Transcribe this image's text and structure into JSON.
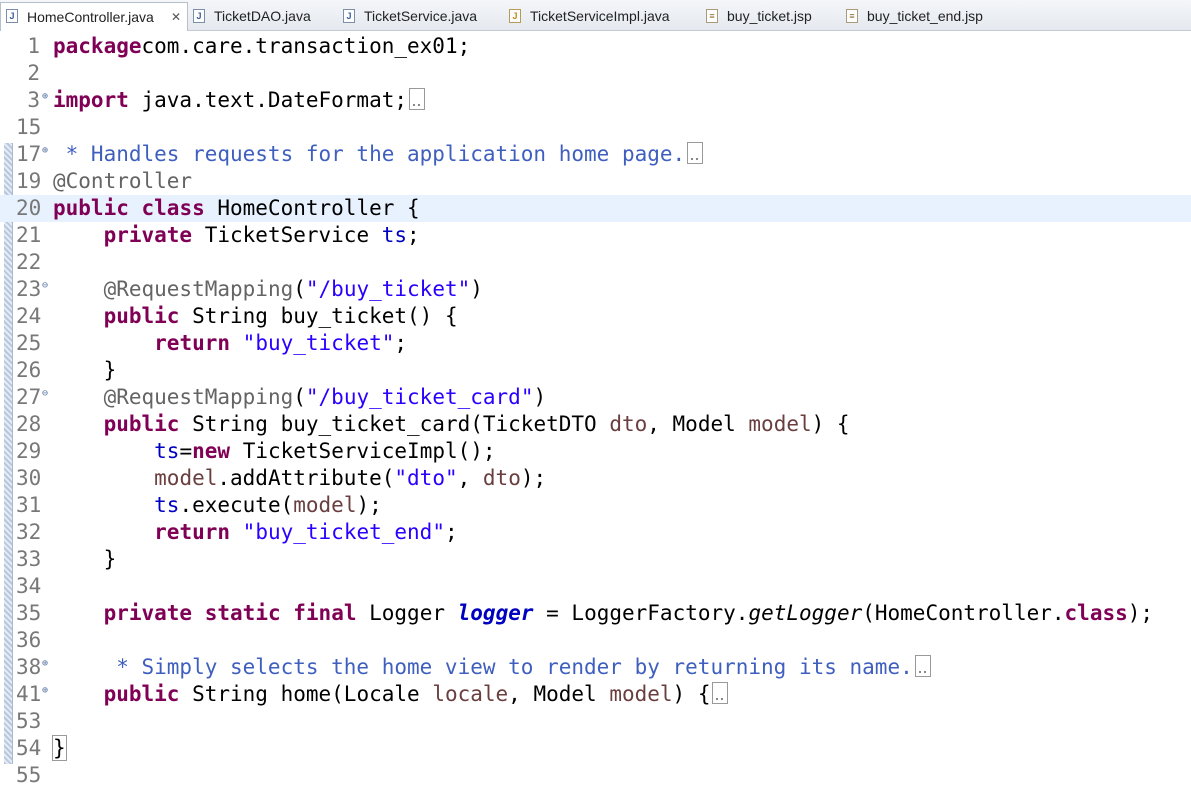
{
  "tabs": [
    {
      "label": "HomeController.java",
      "icon": "java-file-icon",
      "active": true,
      "close": "✕"
    },
    {
      "label": "TicketDAO.java",
      "icon": "java-file-icon"
    },
    {
      "label": "TicketService.java",
      "icon": "java-file-icon"
    },
    {
      "label": "TicketServiceImpl.java",
      "icon": "java-file-icon"
    },
    {
      "label": "buy_ticket.jsp",
      "icon": "jsp-file-icon"
    },
    {
      "label": "buy_ticket_end.jsp",
      "icon": "jsp-file-icon"
    }
  ],
  "editor": {
    "current_line": "20",
    "lines": [
      {
        "n": "1",
        "fold": "",
        "tokens": [
          [
            "kw",
            "package"
          ],
          [
            "",
            "com.care.transaction_ex01;"
          ]
        ]
      },
      {
        "n": "2",
        "fold": "",
        "tokens": []
      },
      {
        "n": "3",
        "fold": "+",
        "tokens": [
          [
            "kw",
            "import"
          ],
          [
            "",
            " java.text.DateFormat;"
          ],
          [
            "box",
            ""
          ]
        ]
      },
      {
        "n": "15",
        "fold": "",
        "tokens": []
      },
      {
        "n": "17",
        "fold": "+",
        "tokens": [
          [
            "cmt",
            " * Handles requests for the application home page."
          ],
          [
            "box",
            ""
          ]
        ]
      },
      {
        "n": "19",
        "fold": "",
        "tokens": [
          [
            "ann",
            "@Controller"
          ]
        ]
      },
      {
        "n": "20",
        "fold": "",
        "tokens": [
          [
            "kw",
            "public"
          ],
          [
            "",
            " "
          ],
          [
            "kw",
            "class"
          ],
          [
            "",
            " HomeController {"
          ]
        ]
      },
      {
        "n": "21",
        "fold": "",
        "tokens": [
          [
            "",
            "    "
          ],
          [
            "kw",
            "private"
          ],
          [
            "",
            " TicketService "
          ],
          [
            "fld",
            "ts"
          ],
          [
            "",
            ";"
          ]
        ]
      },
      {
        "n": "22",
        "fold": "",
        "tokens": []
      },
      {
        "n": "23",
        "fold": "-",
        "tokens": [
          [
            "",
            "    "
          ],
          [
            "ann",
            "@RequestMapping"
          ],
          [
            "",
            "("
          ],
          [
            "str",
            "\"/buy_ticket\""
          ],
          [
            "",
            ")"
          ]
        ]
      },
      {
        "n": "24",
        "fold": "",
        "tokens": [
          [
            "",
            "    "
          ],
          [
            "kw",
            "public"
          ],
          [
            "",
            " String buy_ticket() {"
          ]
        ]
      },
      {
        "n": "25",
        "fold": "",
        "tokens": [
          [
            "",
            "        "
          ],
          [
            "kw",
            "return"
          ],
          [
            "",
            " "
          ],
          [
            "str",
            "\"buy_ticket\""
          ],
          [
            "",
            ";"
          ]
        ]
      },
      {
        "n": "26",
        "fold": "",
        "tokens": [
          [
            "",
            "    }"
          ]
        ]
      },
      {
        "n": "27",
        "fold": "-",
        "tokens": [
          [
            "",
            "    "
          ],
          [
            "ann",
            "@RequestMapping"
          ],
          [
            "",
            "("
          ],
          [
            "str",
            "\"/buy_ticket_card\""
          ],
          [
            "",
            ")"
          ]
        ]
      },
      {
        "n": "28",
        "fold": "",
        "tokens": [
          [
            "",
            "    "
          ],
          [
            "kw",
            "public"
          ],
          [
            "",
            " String buy_ticket_card(TicketDTO "
          ],
          [
            "loc",
            "dto"
          ],
          [
            "",
            ", Model "
          ],
          [
            "loc",
            "model"
          ],
          [
            "",
            ") {"
          ]
        ]
      },
      {
        "n": "29",
        "fold": "",
        "tokens": [
          [
            "",
            "        "
          ],
          [
            "fld",
            "ts"
          ],
          [
            "",
            "="
          ],
          [
            "kw",
            "new"
          ],
          [
            "",
            " TicketServiceImpl();"
          ]
        ]
      },
      {
        "n": "30",
        "fold": "",
        "tokens": [
          [
            "",
            "        "
          ],
          [
            "loc",
            "model"
          ],
          [
            "",
            ".addAttribute("
          ],
          [
            "str",
            "\"dto\""
          ],
          [
            "",
            ", "
          ],
          [
            "loc",
            "dto"
          ],
          [
            "",
            ");"
          ]
        ]
      },
      {
        "n": "31",
        "fold": "",
        "tokens": [
          [
            "",
            "        "
          ],
          [
            "fld",
            "ts"
          ],
          [
            "",
            ".execute("
          ],
          [
            "loc",
            "model"
          ],
          [
            "",
            ");"
          ]
        ]
      },
      {
        "n": "32",
        "fold": "",
        "tokens": [
          [
            "",
            "        "
          ],
          [
            "kw",
            "return"
          ],
          [
            "",
            " "
          ],
          [
            "str",
            "\"buy_ticket_end\""
          ],
          [
            "",
            ";"
          ]
        ]
      },
      {
        "n": "33",
        "fold": "",
        "tokens": [
          [
            "",
            "    }"
          ]
        ]
      },
      {
        "n": "34",
        "fold": "",
        "tokens": []
      },
      {
        "n": "35",
        "fold": "",
        "tokens": [
          [
            "",
            "    "
          ],
          [
            "kw",
            "private"
          ],
          [
            "",
            " "
          ],
          [
            "kw",
            "static"
          ],
          [
            "",
            " "
          ],
          [
            "kw",
            "final"
          ],
          [
            "",
            " Logger "
          ],
          [
            "sfld",
            "logger"
          ],
          [
            "",
            " = LoggerFactory."
          ],
          [
            "ital",
            "getLogger"
          ],
          [
            "",
            "(HomeController."
          ],
          [
            "kw",
            "class"
          ],
          [
            "",
            ");"
          ]
        ]
      },
      {
        "n": "36",
        "fold": "",
        "tokens": []
      },
      {
        "n": "38",
        "fold": "+",
        "tokens": [
          [
            "cmt",
            "     * Simply selects the home view to render by returning its name."
          ],
          [
            "box",
            ""
          ]
        ]
      },
      {
        "n": "41",
        "fold": "+",
        "tokens": [
          [
            "",
            "    "
          ],
          [
            "kw",
            "public"
          ],
          [
            "",
            " String home(Locale "
          ],
          [
            "loc",
            "locale"
          ],
          [
            "",
            ", Model "
          ],
          [
            "loc",
            "model"
          ],
          [
            "",
            ") {"
          ],
          [
            "box",
            ""
          ]
        ]
      },
      {
        "n": "53",
        "fold": "",
        "tokens": []
      },
      {
        "n": "54",
        "fold": "",
        "tokens": [
          [
            "bracebox",
            "}"
          ]
        ]
      },
      {
        "n": "55",
        "fold": "",
        "tokens": []
      }
    ]
  },
  "colors": {
    "keyword": "#7f0055",
    "string": "#2a00ff",
    "annotation": "#646464",
    "comment": "#3f5fbf",
    "field": "#0000c0",
    "local": "#6a3e3e",
    "current_line": "#e8f2fe"
  }
}
